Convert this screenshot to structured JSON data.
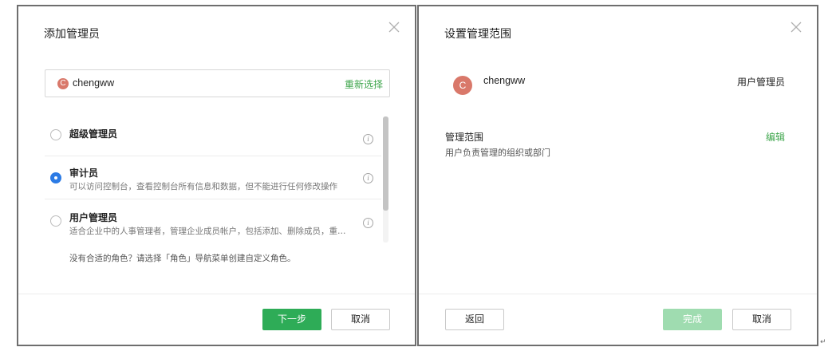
{
  "dialog1": {
    "title": "添加管理员",
    "selected_user": {
      "avatar_letter": "C",
      "name": "chengww",
      "reselect_label": "重新选择"
    },
    "roles": [
      {
        "name": "超级管理员",
        "desc": "",
        "checked": false
      },
      {
        "name": "审计员",
        "desc": "可以访问控制台，查看控制台所有信息和数据，但不能进行任何修改操作",
        "checked": true
      },
      {
        "name": "用户管理员",
        "desc": "适合企业中的人事管理者，管理企业成员帐户，包括添加、删除成员，重置密...",
        "checked": false
      }
    ],
    "info_icon_glyph": "i",
    "hint": "没有合适的角色？请选择「角色」导航菜单创建自定义角色。",
    "next_label": "下一步",
    "cancel_label": "取消"
  },
  "dialog2": {
    "title": "设置管理范围",
    "user": {
      "avatar_letter": "C",
      "name": "chengww",
      "role": "用户管理员"
    },
    "scope_label": "管理范围",
    "scope_desc": "用户负责管理的组织或部门",
    "edit_label": "编辑",
    "back_label": "返回",
    "done_label": "完成",
    "cancel_label": "取消"
  },
  "icons": {
    "close": "close-icon",
    "info": "info-icon",
    "radio": "radio-button"
  },
  "colors": {
    "accent_green": "#2eac57",
    "link_green": "#3fa64d",
    "radio_blue": "#2c7be5",
    "avatar": "#d9786a"
  },
  "corner_mark": "↵"
}
